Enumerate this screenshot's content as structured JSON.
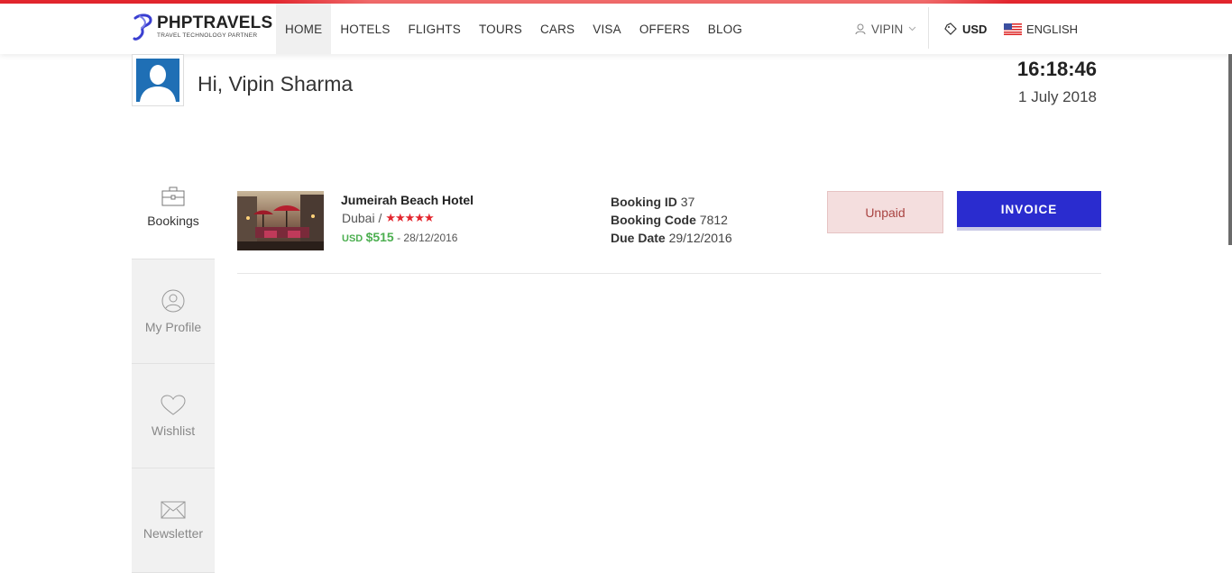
{
  "brand": {
    "name": "PHPTRAVELS",
    "tagline": "TRAVEL TECHNOLOGY PARTNER",
    "accent_color": "#e3262e"
  },
  "nav": {
    "items": [
      {
        "label": "HOME",
        "active": true
      },
      {
        "label": "HOTELS"
      },
      {
        "label": "FLIGHTS"
      },
      {
        "label": "TOURS"
      },
      {
        "label": "CARS"
      },
      {
        "label": "VISA"
      },
      {
        "label": "OFFERS"
      },
      {
        "label": "BLOG"
      }
    ]
  },
  "user_menu": {
    "label": "VIPIN",
    "icon": "user-icon"
  },
  "currency": {
    "label": "USD",
    "icon": "tag-icon"
  },
  "language": {
    "label": "ENGLISH",
    "icon": "us-flag-icon"
  },
  "greeting": {
    "text": "Hi, Vipin Sharma"
  },
  "clock": {
    "time": "16:18:46",
    "date": "1 July 2018"
  },
  "sidebar": {
    "items": [
      {
        "label": "Bookings",
        "icon": "briefcase-icon",
        "active": true
      },
      {
        "label": "My Profile",
        "icon": "profile-icon"
      },
      {
        "label": "Wishlist",
        "icon": "heart-icon"
      },
      {
        "label": "Newsletter",
        "icon": "envelope-icon"
      }
    ]
  },
  "booking": {
    "hotel_name": "Jumeirah Beach Hotel",
    "location": "Dubai /",
    "stars": 5,
    "stars_text": "★★★★★",
    "price_currency": "USD",
    "price_amount": "$515",
    "price_sep": " - ",
    "check_in": "28/12/2016",
    "booking_id_label": "Booking ID",
    "booking_id": "37",
    "booking_code_label": "Booking Code",
    "booking_code": "7812",
    "due_date_label": "Due Date",
    "due_date": "29/12/2016",
    "status": "Unpaid",
    "invoice_label": "INVOICE"
  },
  "colors": {
    "invoice": "#2a2ccf",
    "unpaid_bg": "#f4dede",
    "price": "#4caf50",
    "stars": "#e3262e"
  }
}
